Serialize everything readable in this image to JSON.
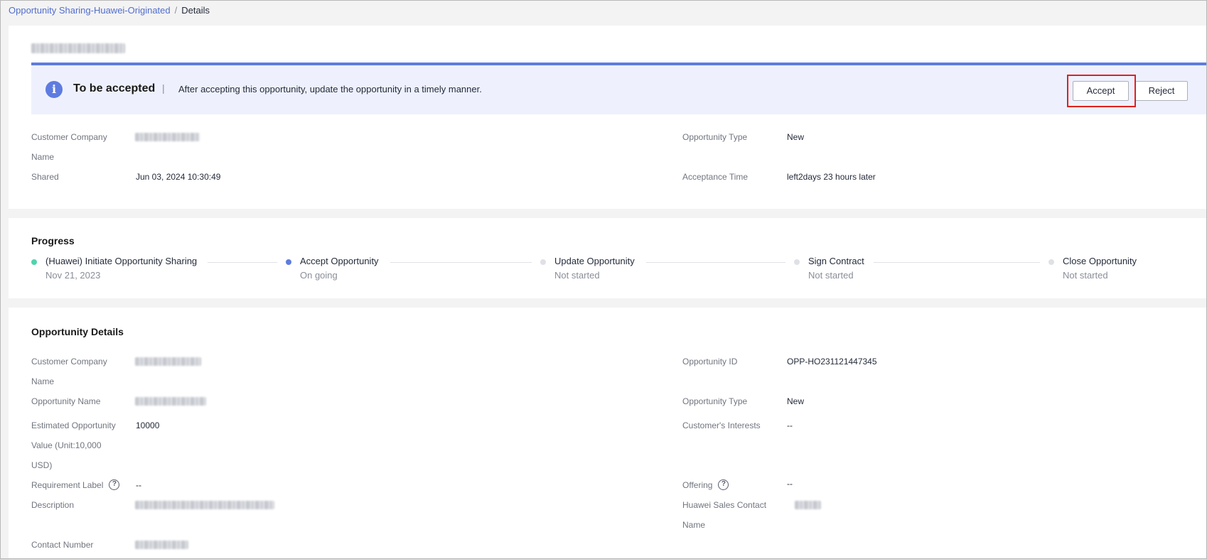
{
  "breadcrumb": {
    "parent": "Opportunity Sharing-Huawei-Originated",
    "separator": "/",
    "current": "Details"
  },
  "status": {
    "title": "To be accepted",
    "separator": "|",
    "message": "After accepting this opportunity, update the opportunity in a timely manner.",
    "accept_label": "Accept",
    "reject_label": "Reject"
  },
  "summary": {
    "customer_company_label_line1": "Customer Company",
    "customer_company_label_line2": "Name",
    "shared_label": "Shared",
    "shared_value": "Jun 03, 2024 10:30:49",
    "opportunity_type_label": "Opportunity Type",
    "opportunity_type_value": "New",
    "acceptance_time_label": "Acceptance Time",
    "acceptance_time_value": "left2days 23 hours later"
  },
  "progress": {
    "title": "Progress",
    "steps": [
      {
        "name": "(Huawei) Initiate Opportunity Sharing",
        "sub": "Nov 21, 2023",
        "state": "done"
      },
      {
        "name": "Accept Opportunity",
        "sub": "On going",
        "state": "current"
      },
      {
        "name": "Update Opportunity",
        "sub": "Not started",
        "state": "pending"
      },
      {
        "name": "Sign Contract",
        "sub": "Not started",
        "state": "pending"
      },
      {
        "name": "Close Opportunity",
        "sub": "Not started",
        "state": "pending"
      }
    ]
  },
  "details": {
    "title": "Opportunity Details",
    "customer_company_label_line1": "Customer Company",
    "customer_company_label_line2": "Name",
    "opportunity_name_label": "Opportunity Name",
    "estimated_value_label_line1": "Estimated Opportunity",
    "estimated_value_label_line2": "Value (Unit:10,000",
    "estimated_value_label_line3": "USD)",
    "estimated_value_value": "10000",
    "requirement_label_label": "Requirement Label",
    "requirement_label_value": "--",
    "description_label": "Description",
    "contact_number_label": "Contact Number",
    "opportunity_id_label": "Opportunity ID",
    "opportunity_id_value": "OPP-HO231121447345",
    "opportunity_type_label": "Opportunity Type",
    "opportunity_type_value": "New",
    "customers_interests_label": "Customer's Interests",
    "customers_interests_value": "--",
    "offering_label": "Offering",
    "offering_value": "--",
    "sales_contact_label_line1": "Huawei Sales Contact",
    "sales_contact_label_line2": "Name"
  },
  "icons": {
    "info": "info-icon",
    "help": "help-circle-icon"
  },
  "colors": {
    "brand": "#5e7ce0",
    "done": "#50d4ab",
    "pending": "#dfe1e6",
    "highlight": "#e02020",
    "link": "#526ecc"
  }
}
